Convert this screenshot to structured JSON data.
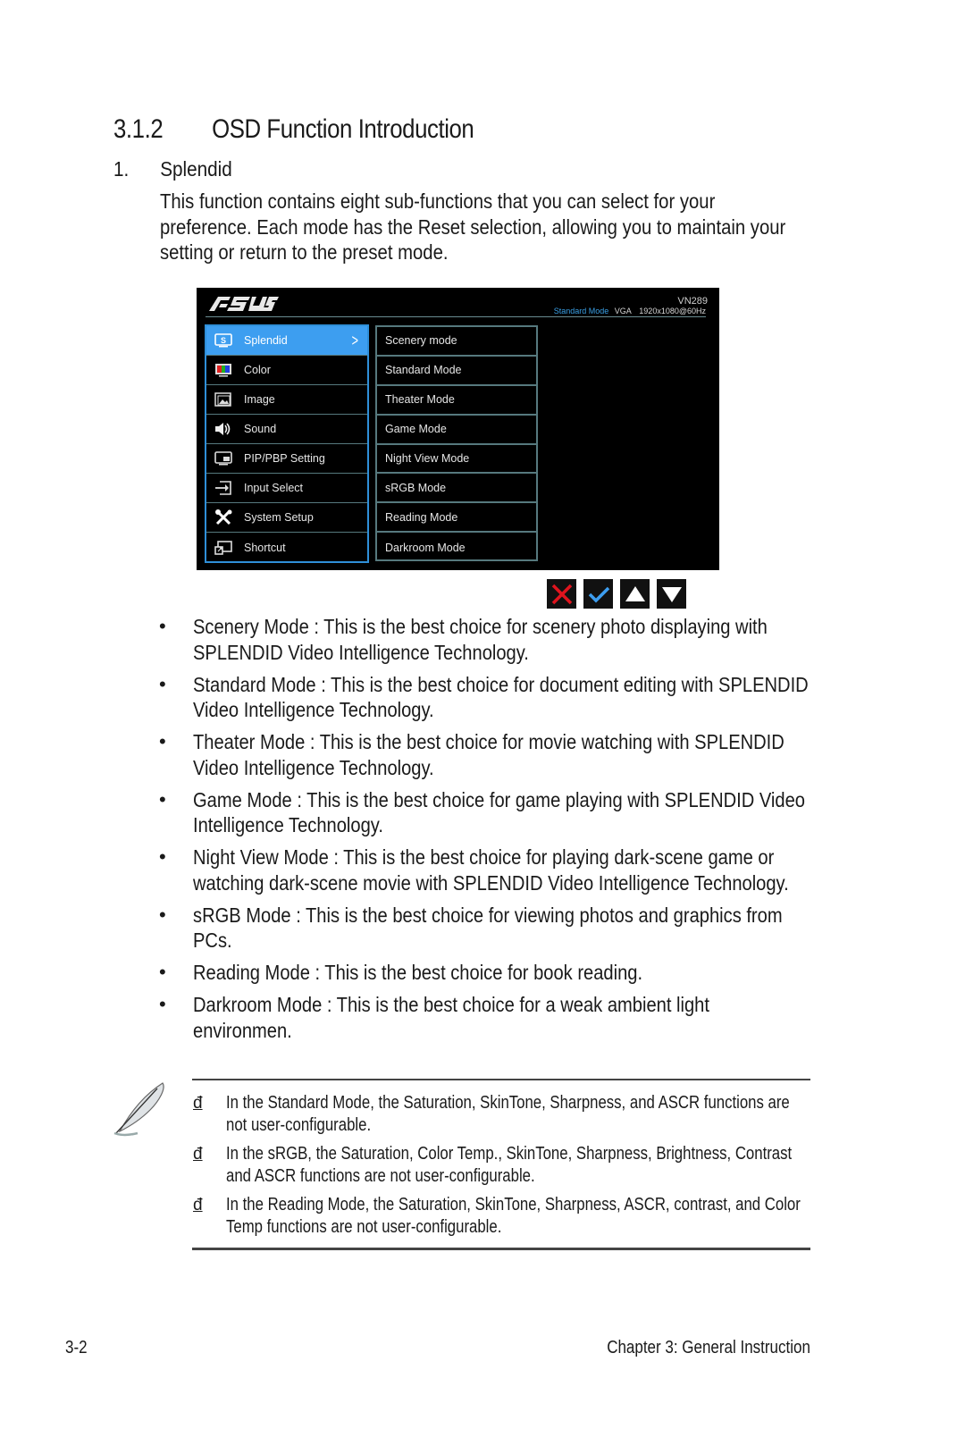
{
  "section": {
    "number": "3.1.2",
    "title": "OSD Function Introduction"
  },
  "subsection": {
    "number": "1.",
    "title": "Splendid"
  },
  "intro": "This function contains eight sub-functions that you can select for your preference. Each mode has the Reset selection, allowing you to maintain your setting or return to the preset mode.",
  "osd": {
    "brand": "ASUS",
    "model": "VN289",
    "status": {
      "mode": "Standard Mode",
      "input": "VGA",
      "resolution": "1920x1080@60Hz"
    },
    "accent_color": "#3d9ef0",
    "menu": [
      {
        "label": "Splendid",
        "icon": "splendid-s-icon",
        "active": true
      },
      {
        "label": "Color",
        "icon": "color-bars-icon",
        "active": false
      },
      {
        "label": "Image",
        "icon": "image-icon",
        "active": false
      },
      {
        "label": "Sound",
        "icon": "speaker-icon",
        "active": false
      },
      {
        "label": "PIP/PBP Setting",
        "icon": "pip-icon",
        "active": false
      },
      {
        "label": "Input Select",
        "icon": "input-select-icon",
        "active": false
      },
      {
        "label": "System Setup",
        "icon": "wrench-screwdriver-icon",
        "active": false
      },
      {
        "label": "Shortcut",
        "icon": "shortcut-icon",
        "active": false
      }
    ],
    "submenu": [
      "Scenery mode",
      "Standard Mode",
      "Theater Mode",
      "Game Mode",
      "Night View Mode",
      "sRGB Mode",
      "Reading Mode",
      "Darkroom Mode"
    ],
    "keys": [
      {
        "name": "close",
        "icon": "close-x-icon",
        "color": "#e0141e"
      },
      {
        "name": "confirm",
        "icon": "checkmark-icon",
        "color": "#3d9ef0"
      },
      {
        "name": "up",
        "icon": "triangle-up-icon",
        "color": "#ffffff"
      },
      {
        "name": "down",
        "icon": "triangle-down-icon",
        "color": "#ffffff"
      }
    ]
  },
  "bullets": [
    "Scenery Mode : This is the best choice for scenery photo displaying with SPLENDID  Video Intelligence Technology.",
    "Standard Mode : This is the best choice for document editing with SPLENDID  Video Intelligence Technology.",
    "Theater Mode : This is the best choice for movie watching with SPLENDID  Video Intelligence Technology.",
    "Game Mode : This is the best choice for game playing with SPLENDID Video Intelligence Technology.",
    "Night View Mode  : This is the best choice for playing dark-scene game or watching dark-scene movie with SPLENDID  Video Intelligence Technology.",
    "sRGB Mode : This is the best choice for viewing photos and graphics from PCs.",
    "Reading Mode : This is the best choice for book reading.",
    "Darkroom Mode  : This is the best choice for a weak ambient light environmen."
  ],
  "bullet_glyph": "•",
  "notes": {
    "marker": "đ",
    "items": [
      "In the Standard Mode, the Saturation, SkinTone, Sharpness, and ASCR functions are not user-configurable.",
      "In the sRGB, the Saturation, Color Temp., SkinTone, Sharpness, Brightness, Contrast and ASCR functions are not user-configurable.",
      "In the Reading Mode, the Saturation, SkinTone, Sharpness, ASCR, contrast, and Color Temp functions are not user-configurable."
    ]
  },
  "footer": {
    "page": "3-2",
    "chapter": "Chapter 3: General Instruction"
  }
}
